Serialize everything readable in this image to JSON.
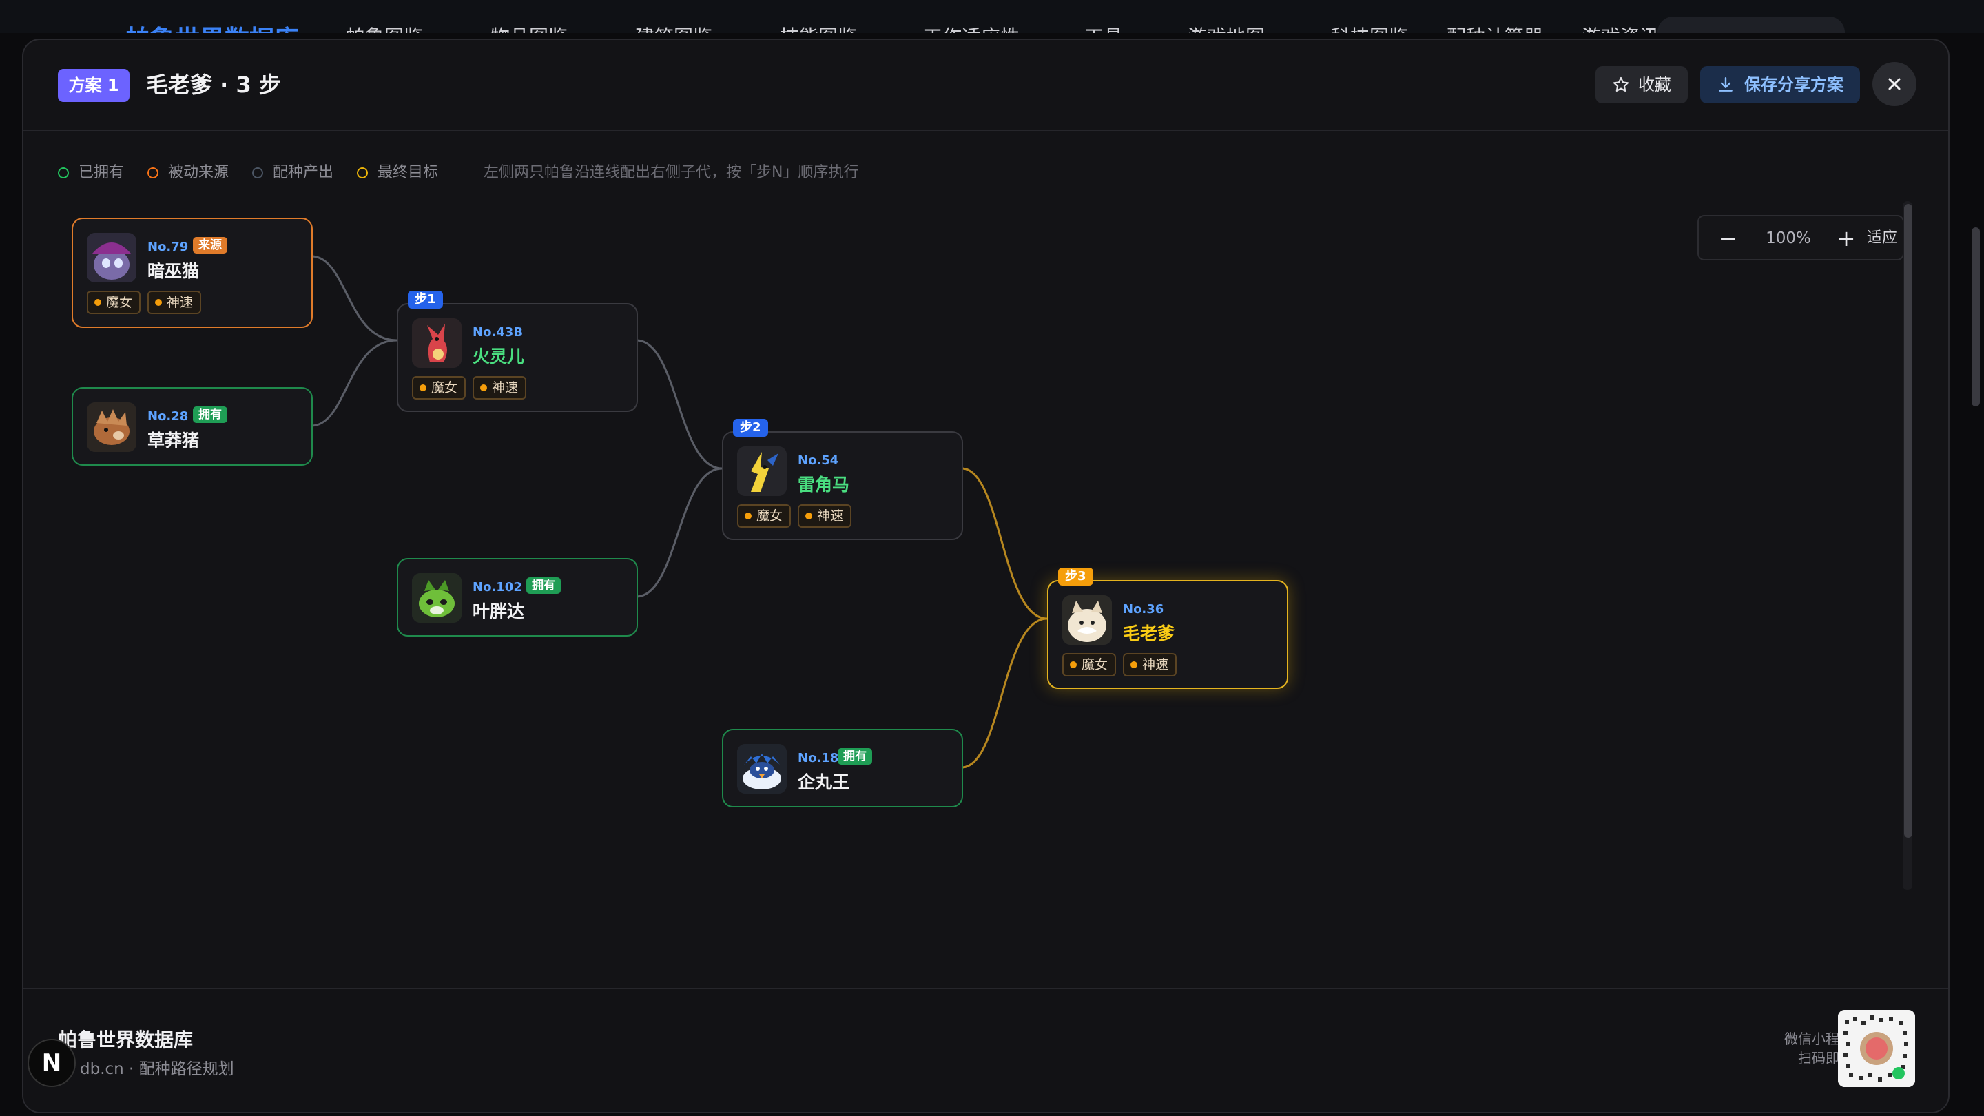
{
  "background_nav": {
    "brand": "帕鲁世界数据库",
    "items": [
      "帕鲁图鉴",
      "物品图鉴",
      "建筑图鉴",
      "技能图鉴",
      "工作适应性",
      "工具",
      "游戏地图",
      "科技图鉴",
      "配种计算器",
      "游戏资讯"
    ]
  },
  "modal": {
    "plan_badge": "方案 1",
    "title": "毛老爹 · 3 步",
    "favorite_label": "收藏",
    "save_label": "保存分享方案"
  },
  "legend": {
    "items": [
      {
        "label": "已拥有",
        "color": "#22c55e"
      },
      {
        "label": "被动来源",
        "color": "#f97316"
      },
      {
        "label": "配种产出",
        "color": "#4b5563"
      },
      {
        "label": "最终目标",
        "color": "#eab308"
      }
    ],
    "hint": "左侧两只帕鲁沿连线配出右侧子代，按「步N」顺序执行"
  },
  "zoom": {
    "minus": "−",
    "level": "100%",
    "plus": "+",
    "fit": "适应"
  },
  "nodes": [
    {
      "id": "n79",
      "no": "No.79",
      "name": "暗巫猫",
      "tag": "来源",
      "kind": "source",
      "passives": [
        "魔女",
        "神速"
      ]
    },
    {
      "id": "n28",
      "no": "No.28",
      "name": "草莽猪",
      "tag": "拥有",
      "kind": "owned",
      "passives": []
    },
    {
      "id": "n43b",
      "no": "No.43B",
      "name": "火灵儿",
      "step": "步1",
      "kind": "bred",
      "passives": [
        "魔女",
        "神速"
      ]
    },
    {
      "id": "n102",
      "no": "No.102",
      "name": "叶胖达",
      "tag": "拥有",
      "kind": "owned",
      "passives": []
    },
    {
      "id": "n54",
      "no": "No.54",
      "name": "雷角马",
      "step": "步2",
      "kind": "bred",
      "passives": [
        "魔女",
        "神速"
      ]
    },
    {
      "id": "n18",
      "no": "No.18",
      "name": "企丸王",
      "tag": "拥有",
      "kind": "owned",
      "passives": []
    },
    {
      "id": "n36",
      "no": "No.36",
      "name": "毛老爹",
      "step": "步3",
      "kind": "target",
      "passives": [
        "魔女",
        "神速"
      ]
    }
  ],
  "colors": {
    "owned": "#22c55e",
    "source": "#f97316",
    "bred": "#3a3a40",
    "target": "#eab308",
    "step_blue": "#2563eb",
    "step_gold": "#f59e0b",
    "edge": "#5a5d66",
    "edge_gold": "#b7871f"
  },
  "footer": {
    "title": "帕鲁世界数据库",
    "subtitle": "db.cn · 配种路径规划",
    "mini_line1": "微信小程序",
    "mini_line2": "扫码即用",
    "next_badge": "N"
  }
}
